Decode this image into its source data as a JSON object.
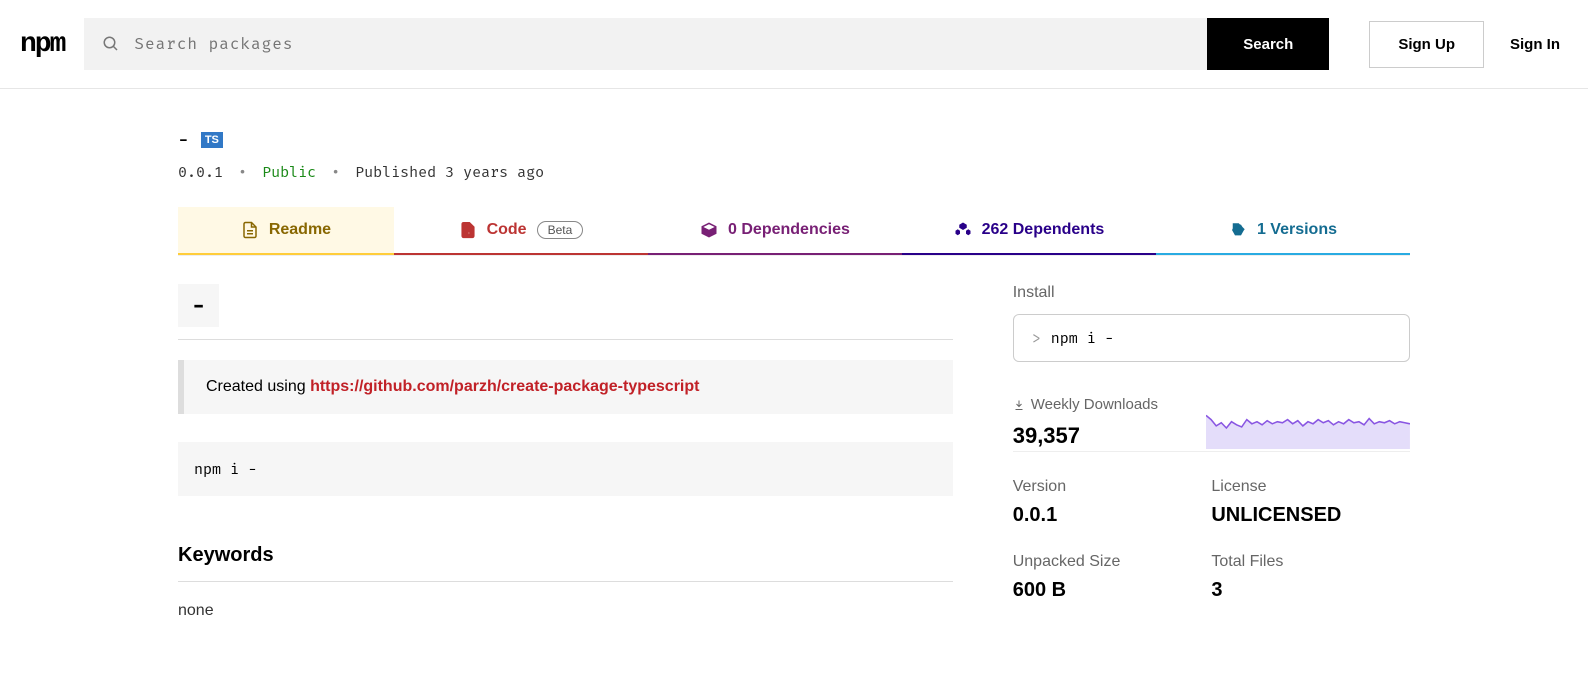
{
  "header": {
    "logo": "npm",
    "search_placeholder": "Search packages",
    "search_button": "Search",
    "signup": "Sign Up",
    "signin": "Sign In"
  },
  "package": {
    "name": "-",
    "ts_badge": "TS",
    "version": "0.0.1",
    "visibility": "Public",
    "published": "Published 3 years ago"
  },
  "tabs": {
    "readme": "Readme",
    "code": "Code",
    "code_beta": "Beta",
    "dependencies": "0 Dependencies",
    "dependents": "262 Dependents",
    "versions": "1 Versions"
  },
  "readme": {
    "title": "-",
    "created_prefix": "Created using ",
    "created_link": "https://github.com/parzh/create-package-typescript",
    "install_cmd": "npm i -",
    "keywords_heading": "Keywords",
    "keywords_none": "none"
  },
  "sidebar": {
    "install_label": "Install",
    "install_prompt": ">",
    "install_cmd": "npm i -",
    "downloads_label": "Weekly Downloads",
    "downloads_count": "39,357",
    "meta": {
      "version_label": "Version",
      "version_value": "0.0.1",
      "license_label": "License",
      "license_value": "UNLICENSED",
      "size_label": "Unpacked Size",
      "size_value": "600 B",
      "files_label": "Total Files",
      "files_value": "3"
    }
  }
}
